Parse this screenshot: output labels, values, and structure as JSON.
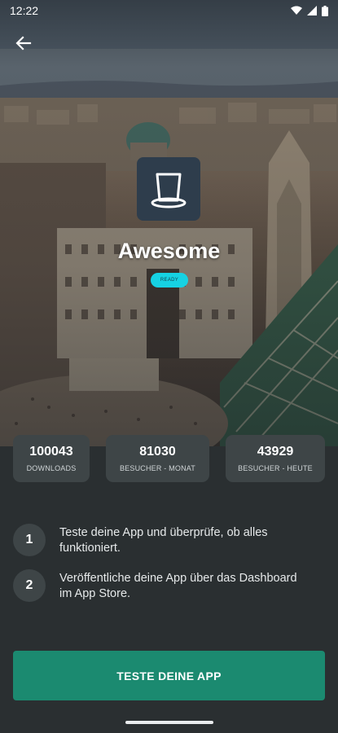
{
  "status_bar": {
    "time": "12:22",
    "icons": [
      "wifi-icon",
      "signal-icon",
      "battery-icon"
    ]
  },
  "header": {
    "back_icon": "arrow-left-icon"
  },
  "app": {
    "icon": "top-hat-icon",
    "name": "Awesome",
    "badge": "READY"
  },
  "stats": [
    {
      "value": "100043",
      "label": "DOWNLOADS"
    },
    {
      "value": "81030",
      "label": "BESUCHER - MONAT"
    },
    {
      "value": "43929",
      "label": "BESUCHER - HEUTE"
    }
  ],
  "steps": [
    {
      "number": "1",
      "text": "Teste deine App und überprüfe, ob alles funktioniert."
    },
    {
      "number": "2",
      "text": "Veröffentliche deine App über das Dashboard im App Store."
    }
  ],
  "cta": {
    "label": "TESTE DEINE APP"
  },
  "colors": {
    "background": "#2a2f31",
    "card": "#3e4547",
    "accent": "#1b8a70",
    "badge": "#16d2e3"
  }
}
